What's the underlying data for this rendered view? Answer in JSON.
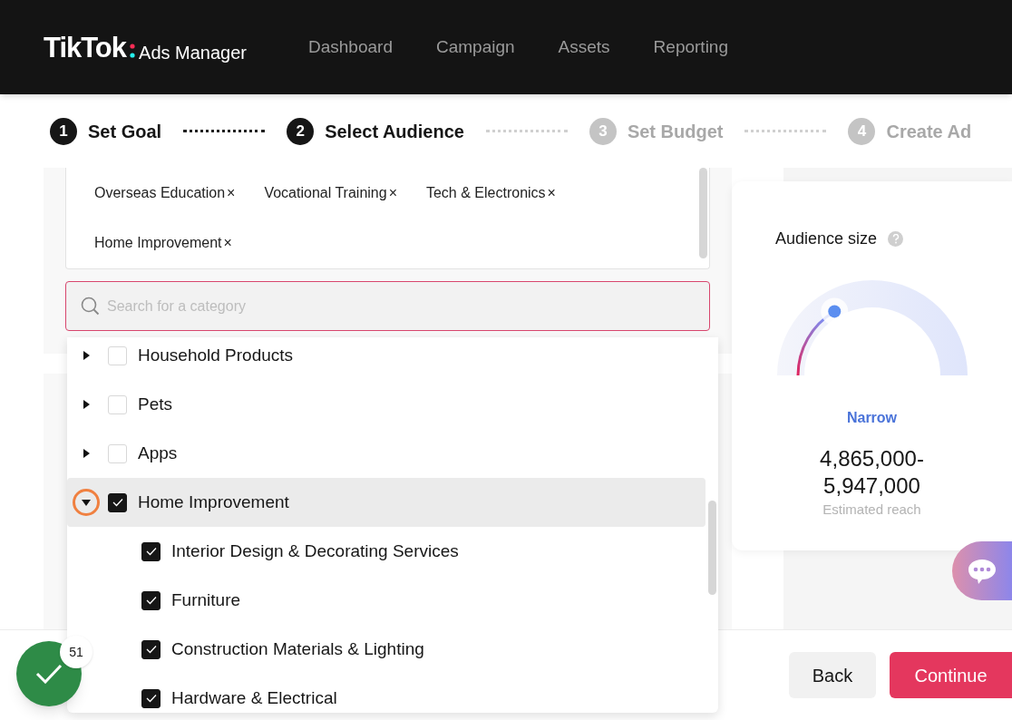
{
  "header": {
    "logo": "TikTok",
    "product": "Ads Manager",
    "nav": [
      "Dashboard",
      "Campaign",
      "Assets",
      "Reporting"
    ]
  },
  "steps": [
    {
      "number": "1",
      "label": "Set Goal",
      "active": true
    },
    {
      "number": "2",
      "label": "Select Audience",
      "active": true
    },
    {
      "number": "3",
      "label": "Set Budget",
      "active": false
    },
    {
      "number": "4",
      "label": "Create Ad",
      "active": false
    }
  ],
  "selected_tags": [
    "Overseas Education",
    "Vocational Training",
    "Tech & Electronics",
    "Home Improvement"
  ],
  "tag_remove": "×",
  "search": {
    "placeholder": "Search for a category"
  },
  "categories": [
    {
      "label": "Household Products",
      "checked": false,
      "expanded": false,
      "selected": false
    },
    {
      "label": "Pets",
      "checked": false,
      "expanded": false,
      "selected": false
    },
    {
      "label": "Apps",
      "checked": false,
      "expanded": false,
      "selected": false
    },
    {
      "label": "Home Improvement",
      "checked": true,
      "expanded": true,
      "selected": true,
      "children": [
        {
          "label": "Interior Design & Decorating Services",
          "checked": true
        },
        {
          "label": "Furniture",
          "checked": true
        },
        {
          "label": "Construction Materials & Lighting",
          "checked": true
        },
        {
          "label": "Hardware & Electrical",
          "checked": true
        }
      ]
    }
  ],
  "audience": {
    "title": "Audience size",
    "level": 0.33,
    "verdict": "Narrow",
    "reach": "4,865,000-5,947,000",
    "reach_label": "Estimated reach"
  },
  "progress_badge": {
    "count": "51"
  },
  "buttons": [
    {
      "label": "Back",
      "kind": "secondary"
    },
    {
      "label": "Continue",
      "kind": "primary"
    }
  ]
}
